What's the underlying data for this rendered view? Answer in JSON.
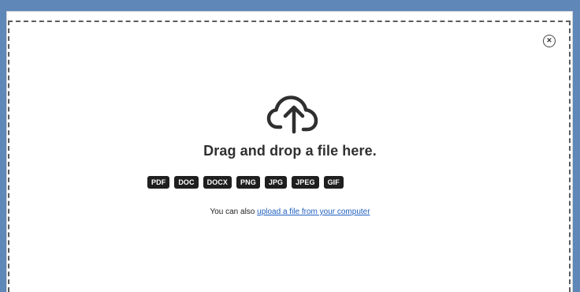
{
  "upload": {
    "title": "Drag and drop a file here.",
    "helper_prefix": "You can also ",
    "helper_link": "upload a file from your computer",
    "close_icon": "circle-close-icon",
    "upload_icon": "cloud-upload-icon"
  },
  "file_types": [
    "PDF",
    "DOC",
    "DOCX",
    "PNG",
    "JPG",
    "JPEG",
    "GIF"
  ],
  "colors": {
    "background": "#5f87b8",
    "panel": "#ffffff",
    "text": "#303030",
    "badge": "#1f1f1f",
    "link": "#1f5fbf"
  }
}
